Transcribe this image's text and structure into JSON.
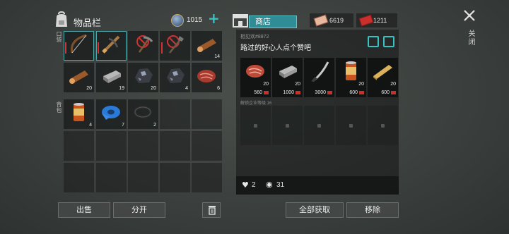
{
  "inventory": {
    "title": "物品栏",
    "coins": "1015",
    "quick_label": "口袋",
    "backpack_label": "背包",
    "slots_row1": [
      {
        "name": "wood-bow-icon",
        "count": ""
      },
      {
        "name": "crossbow-icon",
        "count": ""
      },
      {
        "name": "pickaxe-icon",
        "count": ""
      },
      {
        "name": "shovel-icon",
        "count": ""
      },
      {
        "name": "log-icon",
        "count": "14"
      }
    ],
    "slots_row2": [
      {
        "name": "log-icon",
        "count": "20"
      },
      {
        "name": "iron-ingot-icon",
        "count": "19"
      },
      {
        "name": "iron-ore-icon",
        "count": "20"
      },
      {
        "name": "iron-ore-icon",
        "count": "4"
      },
      {
        "name": "raw-meat-icon",
        "count": "6"
      }
    ],
    "backpack": [
      {
        "name": "canned-food-icon",
        "count": "4"
      },
      {
        "name": "duct-tape-icon",
        "count": "7"
      },
      {
        "name": "gear-icon",
        "count": "2"
      }
    ],
    "sell_button": "出售",
    "split_button": "分开"
  },
  "shop": {
    "tab_label": "商店",
    "currency1": "6619",
    "currency2": "1211",
    "owner": "相见欢#8872",
    "motto": "路过的好心人点个赞吧",
    "items": [
      {
        "name": "raw-meat-icon",
        "count": "20",
        "price": "560"
      },
      {
        "name": "iron-ingot-icon",
        "count": "20",
        "price": "1000"
      },
      {
        "name": "machete-icon",
        "count": "",
        "price": "3000"
      },
      {
        "name": "canned-food-icon",
        "count": "20",
        "price": "600"
      },
      {
        "name": "plank-icon",
        "count": "20",
        "price": "600"
      }
    ],
    "unlock_text": "解锁企业等级 16",
    "likes": "2",
    "views": "31",
    "take_all_button": "全部获取",
    "remove_button": "移除"
  },
  "close_label": "关闭"
}
